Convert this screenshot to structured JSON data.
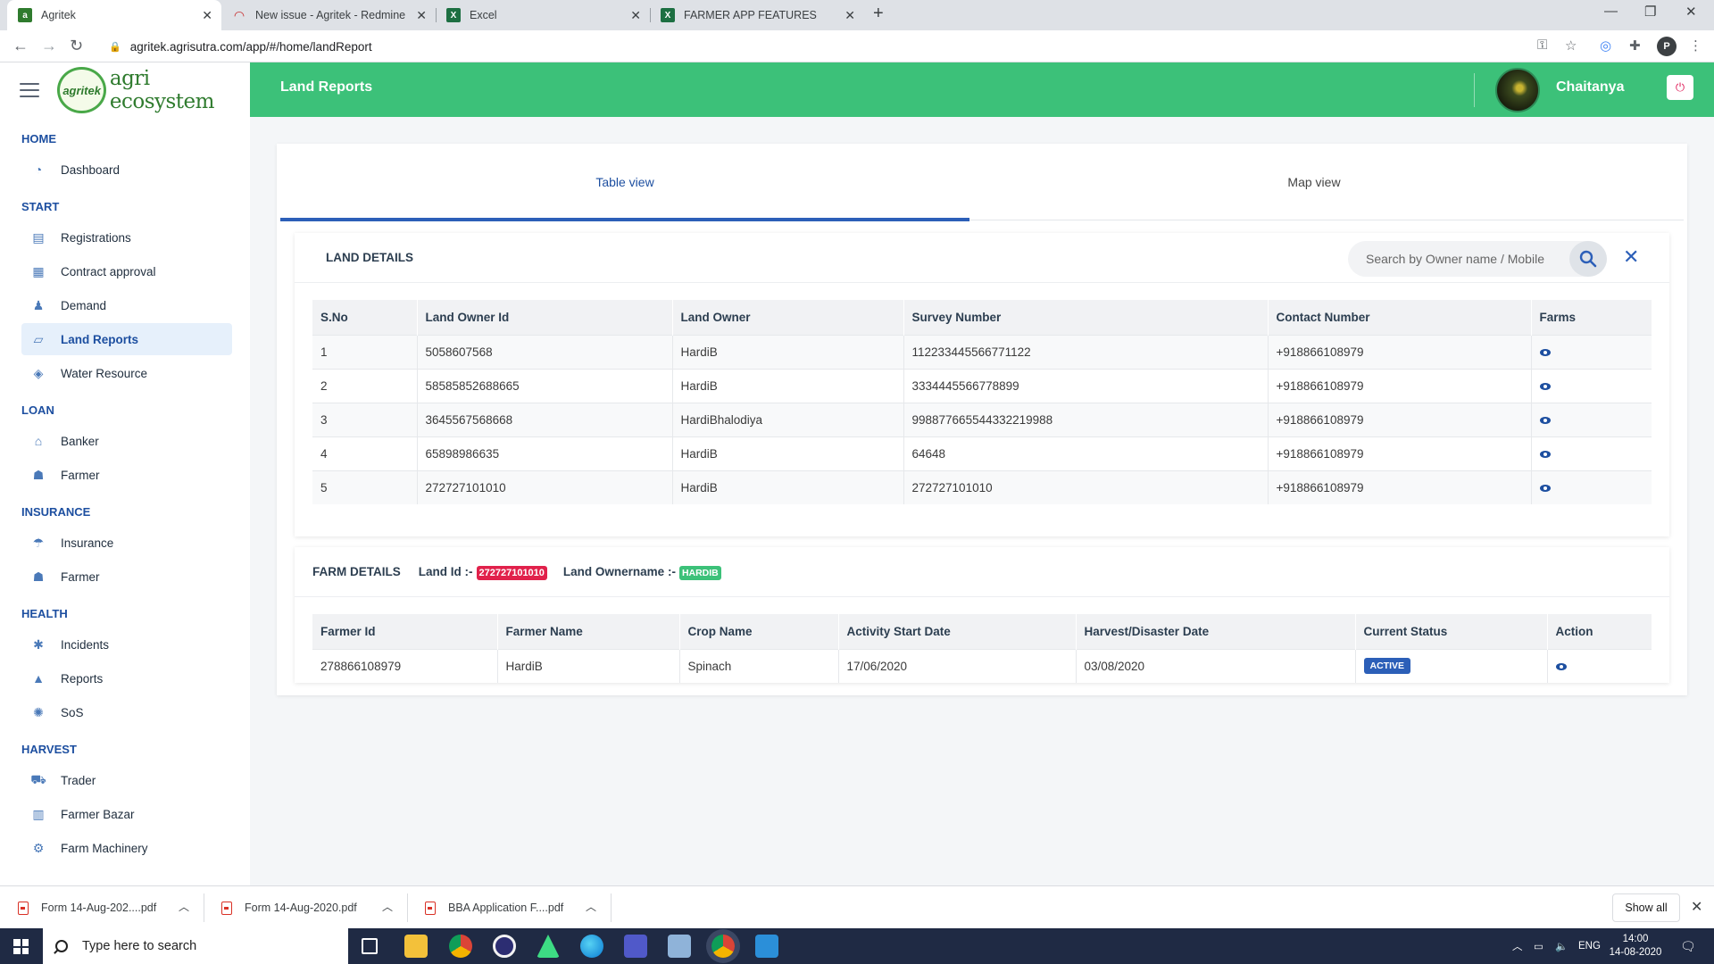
{
  "browser": {
    "tabs": [
      {
        "title": "Agritek",
        "active": true
      },
      {
        "title": "New issue - Agritek - Redmine",
        "active": false
      },
      {
        "title": "Excel",
        "active": false
      },
      {
        "title": "FARMER APP FEATURES",
        "active": false
      }
    ],
    "url": "agritek.agrisutra.com/app/#/home/landReport",
    "profile_initial": "P"
  },
  "brand": {
    "logo_text": "agri ecosystem",
    "logo_mark": "agritek"
  },
  "sidebar": {
    "sections": [
      {
        "title": "HOME",
        "items": [
          {
            "label": "Dashboard",
            "icon": "dashboard-icon"
          }
        ]
      },
      {
        "title": "START",
        "items": [
          {
            "label": "Registrations",
            "icon": "registration-icon"
          },
          {
            "label": "Contract approval",
            "icon": "contract-icon"
          },
          {
            "label": "Demand",
            "icon": "demand-icon"
          },
          {
            "label": "Land Reports",
            "icon": "land-icon",
            "active": true
          },
          {
            "label": "Water Resource",
            "icon": "water-icon"
          }
        ]
      },
      {
        "title": "LOAN",
        "items": [
          {
            "label": "Banker",
            "icon": "bank-icon"
          },
          {
            "label": "Farmer",
            "icon": "farmer-icon"
          }
        ]
      },
      {
        "title": "INSURANCE",
        "items": [
          {
            "label": "Insurance",
            "icon": "insurance-icon"
          },
          {
            "label": "Farmer",
            "icon": "farmer-icon"
          }
        ]
      },
      {
        "title": "HEALTH",
        "items": [
          {
            "label": "Incidents",
            "icon": "incident-icon"
          },
          {
            "label": "Reports",
            "icon": "reports-icon"
          },
          {
            "label": "SoS",
            "icon": "sos-icon"
          }
        ]
      },
      {
        "title": "HARVEST",
        "items": [
          {
            "label": "Trader",
            "icon": "trader-icon"
          },
          {
            "label": "Farmer Bazar",
            "icon": "bazar-icon"
          },
          {
            "label": "Farm Machinery",
            "icon": "machinery-icon"
          }
        ]
      }
    ]
  },
  "header": {
    "title": "Land Reports",
    "user_name": "Chaitanya"
  },
  "view_tabs": {
    "table": "Table view",
    "map": "Map view"
  },
  "land_details": {
    "title": "LAND DETAILS",
    "search_placeholder": "Search by Owner name / Mobile",
    "columns": [
      "S.No",
      "Land Owner Id",
      "Land Owner",
      "Survey Number",
      "Contact Number",
      "Farms"
    ],
    "rows": [
      [
        "1",
        "5058607568",
        "HardiB",
        "112233445566771122",
        "+918866108979"
      ],
      [
        "2",
        "58585852688665",
        "HardiB",
        "3334445566778899",
        "+918866108979"
      ],
      [
        "3",
        "3645567568668",
        "HardiBhalodiya",
        "998877665544332219988",
        "+918866108979"
      ],
      [
        "4",
        "65898986635",
        "HardiB",
        "64648",
        "+918866108979"
      ],
      [
        "5",
        "272727101010",
        "HardiB",
        "272727101010",
        "+918866108979"
      ]
    ]
  },
  "farm_details": {
    "title": "FARM DETAILS",
    "land_id_label": "Land Id :-",
    "land_id": "272727101010",
    "owner_label": "Land Ownername :-",
    "owner": "HARDIB",
    "columns": [
      "Farmer Id",
      "Farmer Name",
      "Crop Name",
      "Activity Start Date",
      "Harvest/Disaster Date",
      "Current Status",
      "Action"
    ],
    "rows": [
      [
        "278866108979",
        "HardiB",
        "Spinach",
        "17/06/2020",
        "03/08/2020",
        "ACTIVE"
      ]
    ]
  },
  "downloads": {
    "items": [
      "Form 14-Aug-202....pdf",
      "Form 14-Aug-2020.pdf",
      "BBA Application F....pdf"
    ],
    "show_all": "Show all"
  },
  "taskbar": {
    "search_placeholder": "Type here to search",
    "lang": "ENG",
    "time": "14:00",
    "date": "14-08-2020"
  },
  "colors": {
    "topbar": "#3cc179",
    "accent": "#2c5fb8",
    "land_id_badge": "#e1214b",
    "owner_badge": "#3cc179"
  }
}
